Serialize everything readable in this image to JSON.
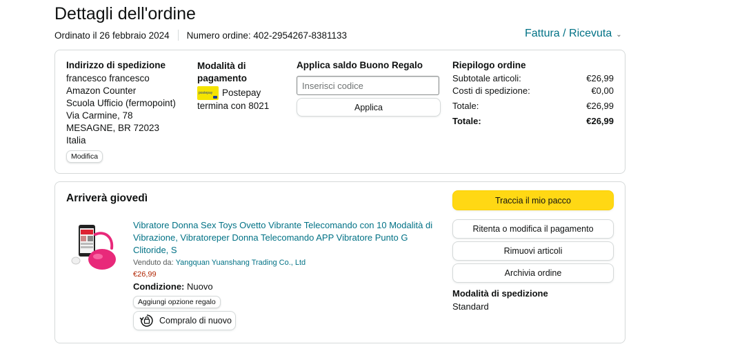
{
  "header": {
    "title": "Dettagli dell'ordine",
    "ordered_on": "Ordinato il 26 febbraio 2024",
    "order_number": "Numero ordine: 402-2954267-8381133",
    "invoice_link": "Fattura / Ricevuta"
  },
  "shipping_address": {
    "heading": "Indirizzo di spedizione",
    "lines": [
      "francesco francesco",
      "Amazon Counter",
      "Scuola Ufficio (fermopoint)",
      "Via Carmine, 78",
      "MESAGNE, BR 72023",
      "Italia"
    ],
    "edit_button": "Modifica"
  },
  "payment": {
    "heading_line1": "Modalità di",
    "heading_line2": "pagamento",
    "card_name": "Postepay",
    "card_icon_text": "postepay",
    "ending": "termina con 8021"
  },
  "gift_card": {
    "heading": "Applica saldo Buono Regalo",
    "placeholder": "Inserisci codice",
    "apply_button": "Applica"
  },
  "summary": {
    "heading": "Riepilogo ordine",
    "rows": [
      {
        "label": "Subtotale articoli:",
        "value": "€26,99"
      },
      {
        "label": "Costi di spedizione:",
        "value": "€0,00"
      },
      {
        "label": "Totale:",
        "value": "€26,99"
      },
      {
        "label": "Totale:",
        "value": "€26,99"
      }
    ]
  },
  "shipment": {
    "heading": "Arriverà giovedì",
    "product_title": "Vibratore Donna Sex Toys Ovetto Vibrante Telecomando con 10 Modalità di Vibrazione, Vibratoreper Donna Telecomando APP Vibratore Punto G Clitoride, S",
    "sold_by_label": "Venduto da:",
    "seller": "Yangquan Yuanshang Trading Co., Ltd",
    "price": "€26,99",
    "condition_label": "Condizione:",
    "condition_value": "Nuovo",
    "gift_button": "Aggiungi opzione regalo",
    "buy_again_button": "Compralo di nuovo",
    "product_image_icon": "product-thumbnail",
    "buy_again_icon": "buy-again-icon"
  },
  "actions": {
    "track": "Traccia il mio pacco",
    "retry_payment": "Ritenta o modifica il pagamento",
    "remove_items": "Rimuovi articoli",
    "archive": "Archivia ordine"
  },
  "shipping_method": {
    "heading": "Modalità di spedizione",
    "value": "Standard"
  },
  "colors": {
    "link": "#007185",
    "price": "#b12704",
    "primary_button": "#ffd814",
    "border": "#d5d9d9",
    "product_pink": "#e8297a"
  }
}
